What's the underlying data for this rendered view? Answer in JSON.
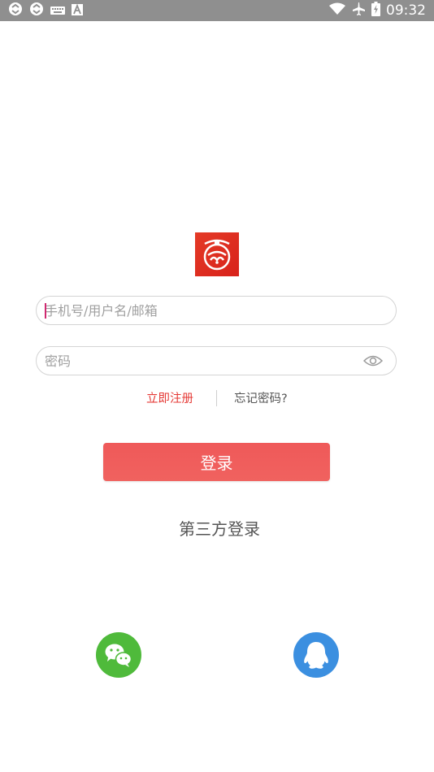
{
  "status_bar": {
    "time": "09:32",
    "left_icons": [
      "sync-icon",
      "sync-icon",
      "keyboard-icon",
      "text-a-icon"
    ],
    "right_icons": [
      "wifi-icon",
      "airplane-icon",
      "battery-icon"
    ]
  },
  "login": {
    "account_placeholder": "手机号/用户名/邮箱",
    "password_placeholder": "密码",
    "register_label": "立即注册",
    "forgot_label": "忘记密码?",
    "submit_label": "登录",
    "third_party_title": "第三方登录"
  },
  "colors": {
    "accent": "#e53935",
    "button": "#ef5959",
    "wechat": "#4fba3b",
    "qq": "#3b8fe0"
  }
}
